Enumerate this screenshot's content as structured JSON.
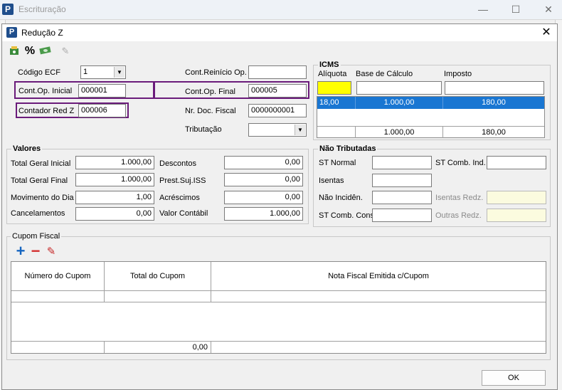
{
  "parent_window": {
    "title": "Escrituração",
    "controls": {
      "minimize": "—",
      "maximize": "☐",
      "close": "✕"
    }
  },
  "dialog": {
    "title": "Redução Z",
    "close": "✕",
    "toolbar": [
      "money-report-icon",
      "percent-icon",
      "money-stack-icon",
      "pen-icon"
    ],
    "toolbar_percent": "%",
    "header": {
      "codigo_ecf_label": "Código ECF",
      "codigo_ecf_value": "1",
      "cont_op_inicial_label": "Cont.Op. Inicial",
      "cont_op_inicial_value": "000001",
      "contador_red_z_label": "Contador Red Z",
      "contador_red_z_value": "000006",
      "cont_reinicio_label": "Cont.Reinício Op.",
      "cont_reinicio_value": "",
      "cont_op_final_label": "Cont.Op. Final",
      "cont_op_final_value": "000005",
      "nr_doc_fiscal_label": "Nr. Doc. Fiscal",
      "nr_doc_fiscal_value": "0000000001",
      "tributacao_label": "Tributação",
      "tributacao_value": ""
    },
    "icms": {
      "legend": "ICMS",
      "col_aliquota": "Alíquota",
      "col_base": "Base de Cálculo",
      "col_imposto": "Imposto",
      "row": {
        "aliquota": "18,00",
        "base": "1.000,00",
        "imposto": "180,00"
      },
      "total": {
        "base": "1.000,00",
        "imposto": "180,00"
      }
    },
    "valores": {
      "legend": "Valores",
      "total_geral_inicial_label": "Total Geral Inicial",
      "total_geral_inicial_value": "1.000,00",
      "total_geral_final_label": "Total Geral Final",
      "total_geral_final_value": "1.000,00",
      "movimento_dia_label": "Movimento do Dia",
      "movimento_dia_value": "1,00",
      "cancelamentos_label": "Cancelamentos",
      "cancelamentos_value": "0,00",
      "descontos_label": "Descontos",
      "descontos_value": "0,00",
      "prest_suj_iss_label": "Prest.Suj.ISS",
      "prest_suj_iss_value": "0,00",
      "acrescimos_label": "Acréscimos",
      "acrescimos_value": "0,00",
      "valor_contabil_label": "Valor Contábil",
      "valor_contabil_value": "1.000,00"
    },
    "nao_tributadas": {
      "legend": "Não Tributadas",
      "st_normal_label": "ST Normal",
      "st_comb_ind_label": "ST Comb. Ind.",
      "isentas_label": "Isentas",
      "nao_incid_label": "Não Incidên.",
      "isentas_redz_label": "Isentas Redz.",
      "st_comb_cons_label": "ST Comb. Cons",
      "outras_redz_label": "Outras Redz."
    },
    "cupom": {
      "legend": "Cupom Fiscal",
      "col_numero": "Número do Cupom",
      "col_total": "Total do Cupom",
      "col_nota": "Nota Fiscal Emitida c/Cupom",
      "footer_total": "0,00",
      "add_icon": "+",
      "remove_icon": "−",
      "edit_icon": "✎"
    },
    "ok_button": "OK"
  }
}
